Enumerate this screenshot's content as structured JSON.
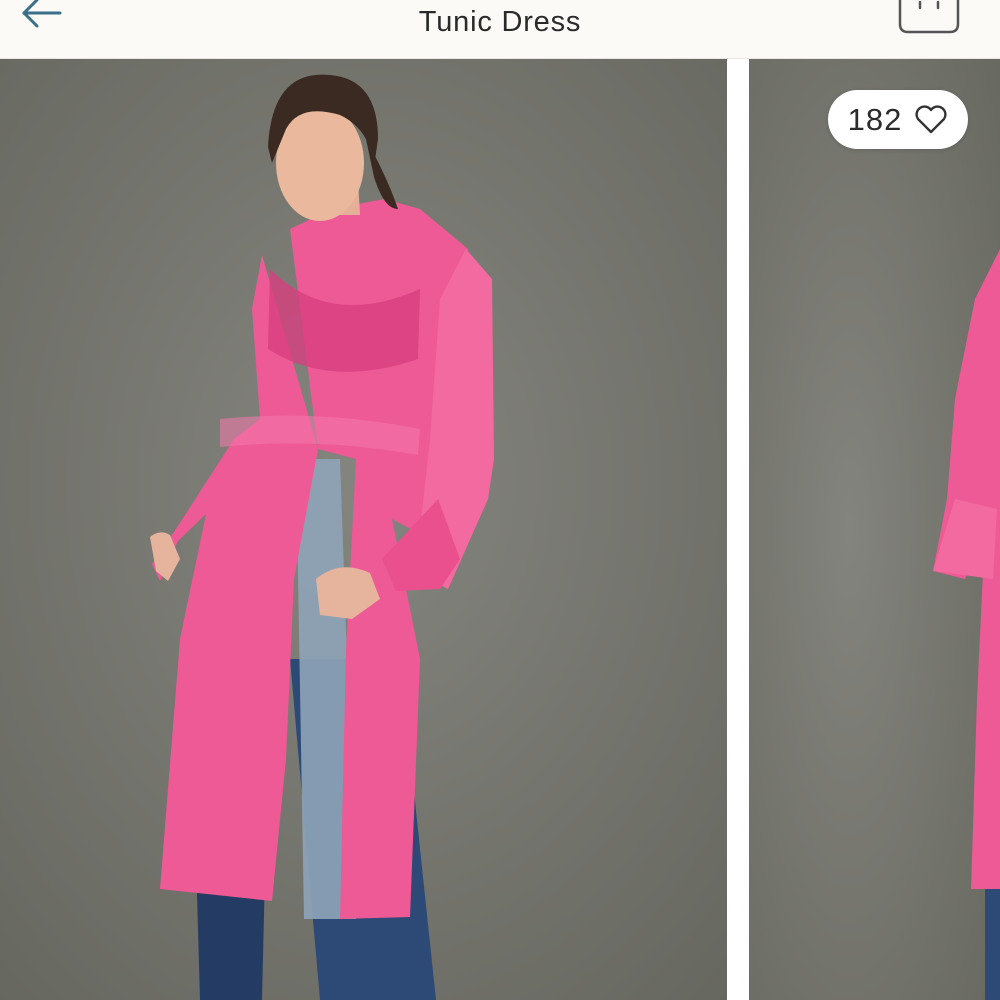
{
  "header": {
    "title": "Tunic Dress",
    "back_icon": "arrow-left-icon",
    "cart_icon": "shopping-bag-icon"
  },
  "product_images": [
    {
      "description_icon": "product-photo"
    },
    {
      "description_icon": "product-photo"
    }
  ],
  "likes": {
    "count": "182",
    "icon": "heart-outline-icon"
  },
  "colors": {
    "accent": "#3a6f8a",
    "background_photo": "#767771",
    "dress_pink": "#ea4f8e"
  }
}
